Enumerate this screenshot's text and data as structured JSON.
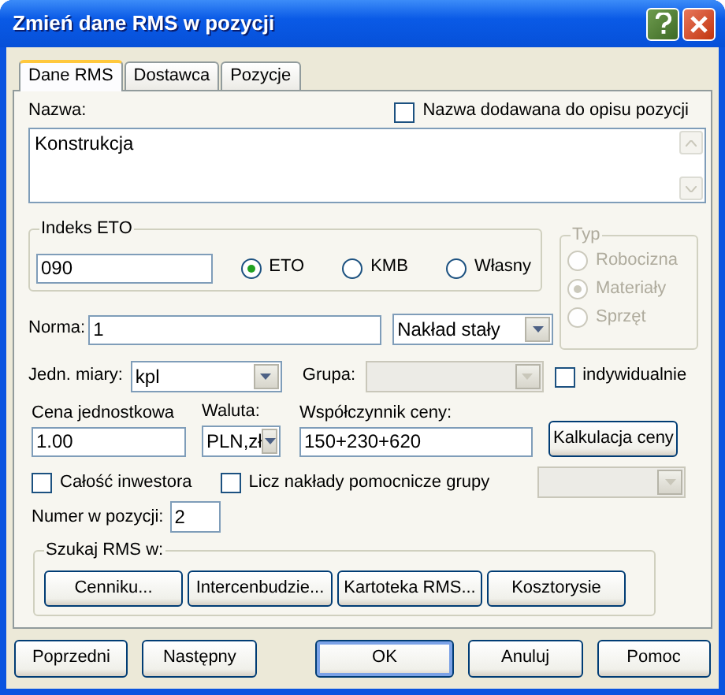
{
  "window": {
    "title": "Zmień dane RMS w pozycji"
  },
  "tabs": [
    {
      "label": "Dane RMS",
      "selected": true
    },
    {
      "label": "Dostawca",
      "selected": false
    },
    {
      "label": "Pozycje",
      "selected": false
    }
  ],
  "nazwa": {
    "label": "Nazwa:",
    "value": "Konstrukcja"
  },
  "nazwa_checkbox": {
    "label": "Nazwa dodawana do opisu pozycji",
    "checked": false
  },
  "indeks": {
    "legend": "Indeks ETO",
    "value": "090",
    "options": [
      {
        "label": "ETO",
        "selected": true
      },
      {
        "label": "KMB",
        "selected": false
      },
      {
        "label": "Własny",
        "selected": false
      }
    ]
  },
  "typ": {
    "legend": "Typ",
    "disabled": true,
    "options": [
      {
        "label": "Robocizna",
        "selected": false
      },
      {
        "label": "Materiały",
        "selected": true
      },
      {
        "label": "Sprzęt",
        "selected": false
      }
    ]
  },
  "norma": {
    "label": "Norma:",
    "value": "1",
    "mode": "Nakład stały"
  },
  "jedn": {
    "label": "Jedn. miary:",
    "value": "kpl"
  },
  "grupa": {
    "label": "Grupa:",
    "disabled": true
  },
  "indywidualnie": {
    "label": "indywidualnie",
    "checked": false
  },
  "cena": {
    "label": "Cena jednostkowa",
    "value": "1.00"
  },
  "waluta": {
    "label": "Waluta:",
    "value": "PLN,zł"
  },
  "wspolczynnik": {
    "label": "Współczynnik ceny:",
    "value": "150+230+620"
  },
  "kalkulacja": {
    "label": "Kalkulacja ceny"
  },
  "checks": [
    {
      "label": "Całość inwestora",
      "checked": false
    },
    {
      "label": "Licz nakłady pomocnicze grupy",
      "checked": false
    }
  ],
  "grupa_select": {
    "disabled": true
  },
  "numer": {
    "label": "Numer w pozycji:",
    "value": "2"
  },
  "szukaj": {
    "legend": "Szukaj RMS w:",
    "buttons": [
      "Cenniku...",
      "Intercenbudzie...",
      "Kartoteka RMS...",
      "Kosztorysie"
    ]
  },
  "footer_buttons": [
    {
      "label": "Poprzedni",
      "default": false
    },
    {
      "label": "Następny",
      "default": false
    },
    {
      "label": "OK",
      "default": true
    },
    {
      "label": "Anuluj",
      "default": false
    },
    {
      "label": "Pomoc",
      "default": false
    }
  ]
}
